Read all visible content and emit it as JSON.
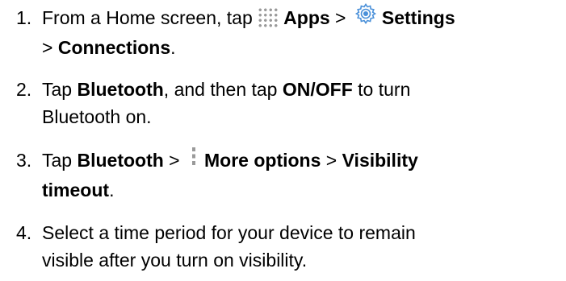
{
  "steps": [
    {
      "number": "1.",
      "text_a": "From a Home screen, tap ",
      "apps_label": "Apps",
      "sep_1": " > ",
      "settings_label": "Settings",
      "line2_prefix": "> ",
      "connections_label": "Connections",
      "line2_suffix": ".",
      "icons": [
        "apps-icon",
        "gear-icon"
      ]
    },
    {
      "number": "2.",
      "text_a": "Tap ",
      "bluetooth_label": "Bluetooth",
      "text_b": ", and then tap ",
      "onoff_label": "ON/OFF",
      "text_c": " to turn",
      "line2": "Bluetooth on."
    },
    {
      "number": "3.",
      "text_a": "Tap ",
      "bluetooth_label": "Bluetooth",
      "sep_1": " > ",
      "more_label": "More options",
      "sep_2": " > ",
      "visibility_label": "Visibility",
      "timeout_label": "timeout",
      "line2_suffix": ".",
      "icons": [
        "more-options-icon"
      ]
    },
    {
      "number": "4.",
      "line1": "Select a time period for your device to remain",
      "line2": "visible after you turn on visibility."
    }
  ],
  "colors": {
    "text": "#000000",
    "icon_gray": "#9a9a9a",
    "gear_blue": "#4a90d9"
  }
}
